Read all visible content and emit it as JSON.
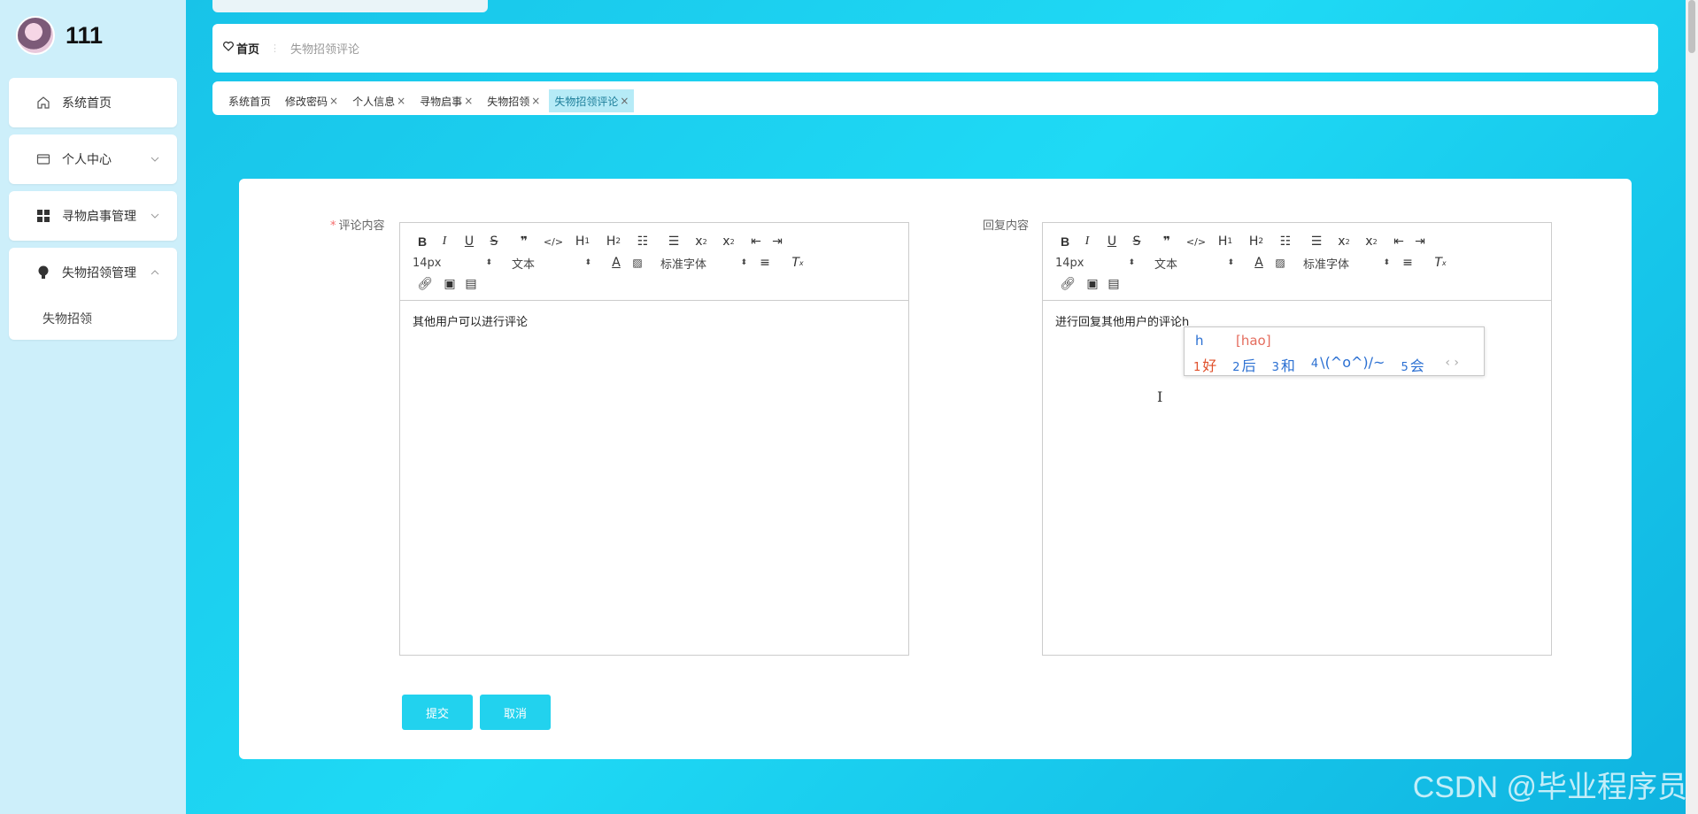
{
  "sidebar": {
    "title": "111",
    "items": [
      {
        "label": "系统首页",
        "icon": "home-icon"
      },
      {
        "label": "个人中心",
        "icon": "card-icon"
      },
      {
        "label": "寻物启事管理",
        "icon": "grid-icon"
      },
      {
        "label": "失物招领管理",
        "icon": "bulb-icon"
      }
    ],
    "sub_item": "失物招领"
  },
  "breadcrumb": {
    "home": "首页",
    "current": "失物招领评论"
  },
  "tags": [
    {
      "label": "系统首页",
      "closable": false
    },
    {
      "label": "修改密码",
      "closable": true
    },
    {
      "label": "个人信息",
      "closable": true
    },
    {
      "label": "寻物启事",
      "closable": true
    },
    {
      "label": "失物招领",
      "closable": true
    },
    {
      "label": "失物招领评论",
      "closable": true,
      "active": true
    }
  ],
  "form": {
    "comment_label": "评论内容",
    "reply_label": "回复内容",
    "comment_text": "其他用户可以进行评论",
    "reply_text": "进行回复其他用户的评论h",
    "submit": "提交",
    "cancel": "取消"
  },
  "editor_toolbar": {
    "size": "14px",
    "format": "文本",
    "font": "标准字体"
  },
  "ime": {
    "input": "h",
    "pinyin": "[hao]",
    "candidates": [
      {
        "n": "1",
        "text": "好"
      },
      {
        "n": "2",
        "text": "后"
      },
      {
        "n": "3",
        "text": "和"
      },
      {
        "n": "4",
        "text": "\\(^o^)/~"
      },
      {
        "n": "5",
        "text": "会"
      }
    ],
    "nav": "‹ ›"
  },
  "watermark": "CSDN @毕业程序员",
  "colors": {
    "accent": "#22d2ee",
    "sidebar_bg": "#cdeffa",
    "active_tag": "#b6ebf7"
  }
}
